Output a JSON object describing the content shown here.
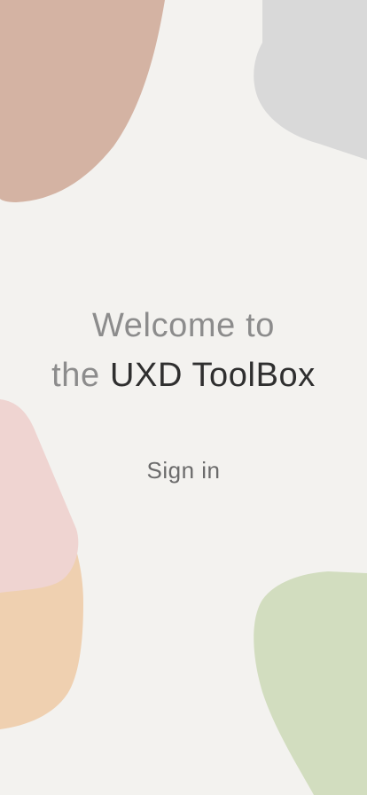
{
  "welcome": {
    "line1": "Welcome to",
    "line2_prefix": "the",
    "line2_brand": "UXD ToolBox"
  },
  "actions": {
    "sign_in_label": "Sign in"
  },
  "colors": {
    "background": "#F3F2EF",
    "blob_brown": "#D4B3A3",
    "blob_grey": "#D9D9D9",
    "blob_pink": "#EFD4D1",
    "blob_peach": "#EFD0B0",
    "blob_green": "#D2DDBF",
    "text_muted": "#8C8C8C",
    "text_strong": "#2F2F2F"
  }
}
